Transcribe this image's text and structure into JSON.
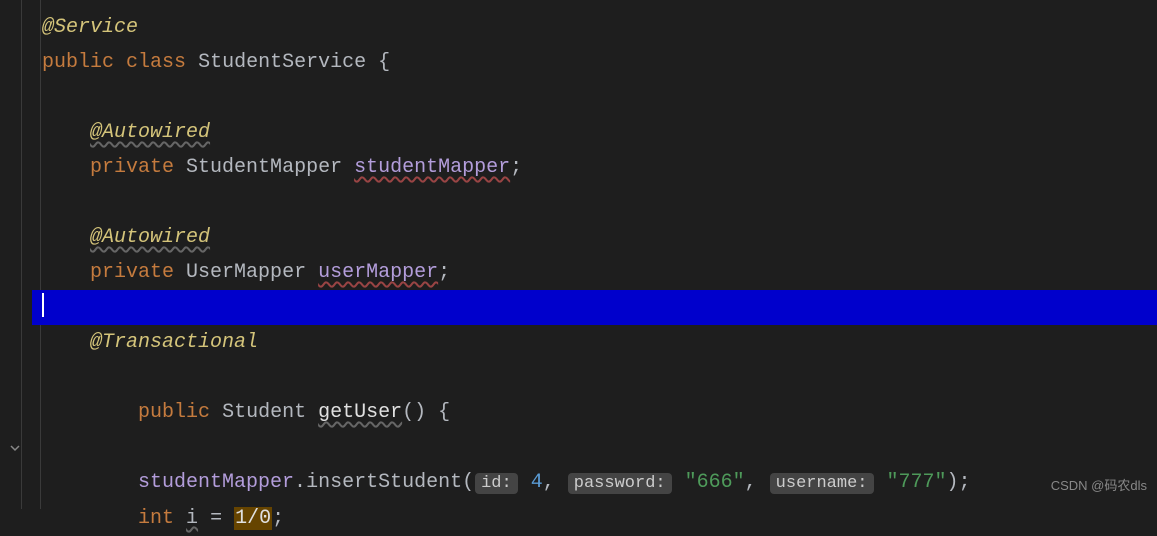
{
  "code": {
    "l1": {
      "anno": "@Service"
    },
    "l2": {
      "kw1": "public",
      "kw2": "class",
      "type": "StudentService",
      "brace": " {"
    },
    "l4": {
      "anno": "@Autowired"
    },
    "l5": {
      "kw": "private",
      "type": "StudentMapper",
      "field": "studentMapper",
      "end": ";"
    },
    "l7": {
      "anno": "@Autowired"
    },
    "l8": {
      "kw": "private",
      "type": "UserMapper",
      "field": "userMapper",
      "end": ";"
    },
    "l10": {
      "anno": "@Transactional"
    },
    "l11": {
      "kw": "public",
      "type": "Student",
      "method": "getUser",
      "parens": "()",
      "brace": " {"
    },
    "l13": {
      "field": "studentMapper",
      "dot": ".",
      "method": "insertStudent",
      "open": "(",
      "hint1": "id:",
      "spc1": " ",
      "arg1": "4",
      "comma1": ",",
      "spc2": " ",
      "hint2": "password:",
      "spc3": " ",
      "arg2": "\"666\"",
      "comma2": ",",
      "spc4": " ",
      "hint3": "username:",
      "spc5": " ",
      "arg3": "\"777\"",
      "close": ");"
    },
    "l14": {
      "kw": "int",
      "var": "i",
      "eq": " = ",
      "expr": "1/0",
      "end": ";"
    }
  },
  "watermark": "CSDN @码农dls"
}
